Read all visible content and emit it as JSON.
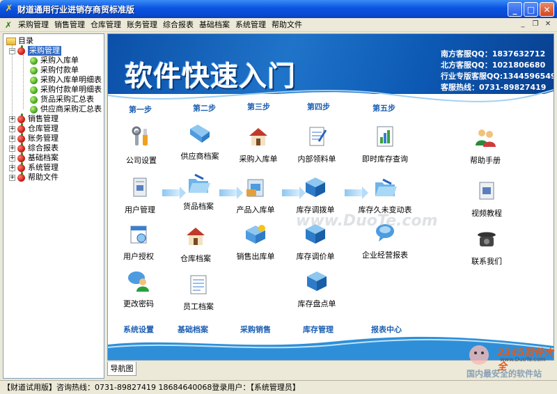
{
  "window": {
    "title": "财道通用行业进销存商贸标准版"
  },
  "menu": [
    "采购管理",
    "销售管理",
    "仓库管理",
    "账务管理",
    "综合报表",
    "基础档案",
    "系统管理",
    "帮助文件"
  ],
  "tree": {
    "root": "目录",
    "nodes": [
      {
        "label": "采购管理",
        "expanded": true,
        "selected": true,
        "children": [
          "采购入库单",
          "采购付款单",
          "采购入库单明细表",
          "采购付款单明细表",
          "货品采购汇总表",
          "供应商采购汇总表"
        ]
      },
      {
        "label": "销售管理"
      },
      {
        "label": "仓库管理"
      },
      {
        "label": "账务管理"
      },
      {
        "label": "综合报表"
      },
      {
        "label": "基础档案"
      },
      {
        "label": "系统管理"
      },
      {
        "label": "帮助文件"
      }
    ]
  },
  "banner": {
    "title": "软件快速入门",
    "contacts": [
      "南方客服QQ：1837632712",
      "北方客服QQ：1021806680",
      "行业专版客服QQ:1344596549",
      "客服热线：0731-89827419"
    ]
  },
  "steps": [
    "第一步",
    "第二步",
    "第三步",
    "第四步",
    "第五步"
  ],
  "items": [
    {
      "label": "公司设置",
      "icon": "tools-icon"
    },
    {
      "label": "供应商档案",
      "icon": "folder-icon"
    },
    {
      "label": "采购入库单",
      "icon": "house-icon"
    },
    {
      "label": "内部领料单",
      "icon": "document-icon"
    },
    {
      "label": "即时库存查询",
      "icon": "chart-icon"
    },
    {
      "label": "帮助手册",
      "icon": "users-icon"
    },
    {
      "label": "用户管理",
      "icon": "book-icon"
    },
    {
      "label": "货品档案",
      "icon": "folder-open-icon"
    },
    {
      "label": "产品入库单",
      "icon": "box-icon"
    },
    {
      "label": "库存调拨单",
      "icon": "cube-icon"
    },
    {
      "label": "库存久未变动表",
      "icon": "folder-open-icon"
    },
    {
      "label": "视频教程",
      "icon": "video-icon"
    },
    {
      "label": "用户授权",
      "icon": "calendar-icon"
    },
    {
      "label": "仓库档案",
      "icon": "house-icon"
    },
    {
      "label": "销售出库单",
      "icon": "star-box-icon"
    },
    {
      "label": "库存调价单",
      "icon": "cube-icon"
    },
    {
      "label": "企业经营报表",
      "icon": "chat-icon"
    },
    {
      "label": "联系我们",
      "icon": "phone-icon"
    },
    {
      "label": "更改密码",
      "icon": "user-chat-icon"
    },
    {
      "label": "员工档案",
      "icon": "form-icon"
    },
    {
      "label": "库存盘点单",
      "icon": "cube-icon"
    }
  ],
  "bottom_sections": [
    "系统设置",
    "基础档案",
    "采购销售",
    "库存管理",
    "报表中心"
  ],
  "tab": "导航图",
  "status": "【财道试用版】咨询热线：0731-89827419 18684640068登录用户：【系统管理员】",
  "corner_logo": {
    "brand": "2345软件大全",
    "url": "www.DuoTe.com",
    "slogan": "国内最安全的软件站"
  },
  "watermark": "www.DuoTe.com",
  "colors": {
    "titlebar": "#0a54e3",
    "banner": "#1f74c9",
    "accent": "#1d5fb2"
  }
}
